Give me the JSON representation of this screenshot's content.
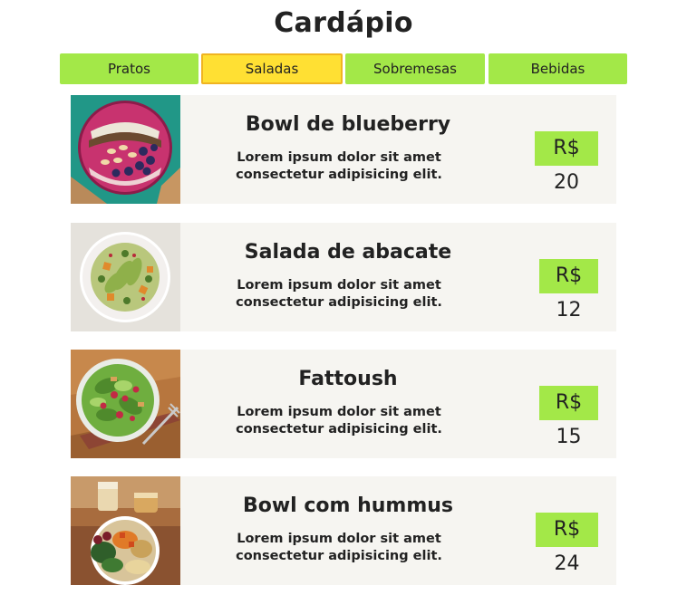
{
  "page": {
    "title": "Cardápio"
  },
  "tabs": [
    {
      "label": "Pratos",
      "active": false
    },
    {
      "label": "Saladas",
      "active": true
    },
    {
      "label": "Sobremesas",
      "active": false
    },
    {
      "label": "Bebidas",
      "active": false
    }
  ],
  "menu_items": [
    {
      "name": "Bowl de blueberry",
      "description_line1": "Lorem ipsum dolor sit amet",
      "description_line2": "consectetur adipisicing elit.",
      "price": "R$ 20",
      "image": "blueberry-bowl-photo"
    },
    {
      "name": "Salada de abacate",
      "description_line1": "Lorem ipsum dolor sit amet",
      "description_line2": "consectetur adipisicing elit.",
      "price": "R$ 12",
      "image": "avocado-salad-photo"
    },
    {
      "name": "Fattoush",
      "description_line1": "Lorem ipsum dolor sit amet",
      "description_line2": "consectetur adipisicing elit.",
      "price": "R$ 15",
      "image": "fattoush-salad-photo"
    },
    {
      "name": "Bowl com hummus",
      "description_line1": "Lorem ipsum dolor sit amet",
      "description_line2": "consectetur adipisicing elit.",
      "price": "R$ 24",
      "image": "hummus-bowl-photo"
    }
  ],
  "colors": {
    "tab_bg": "#a3e848",
    "tab_active_bg": "#ffe033",
    "tab_active_border": "#f0b421",
    "card_bg": "#f6f5f1",
    "price_bg": "#a3e848"
  }
}
